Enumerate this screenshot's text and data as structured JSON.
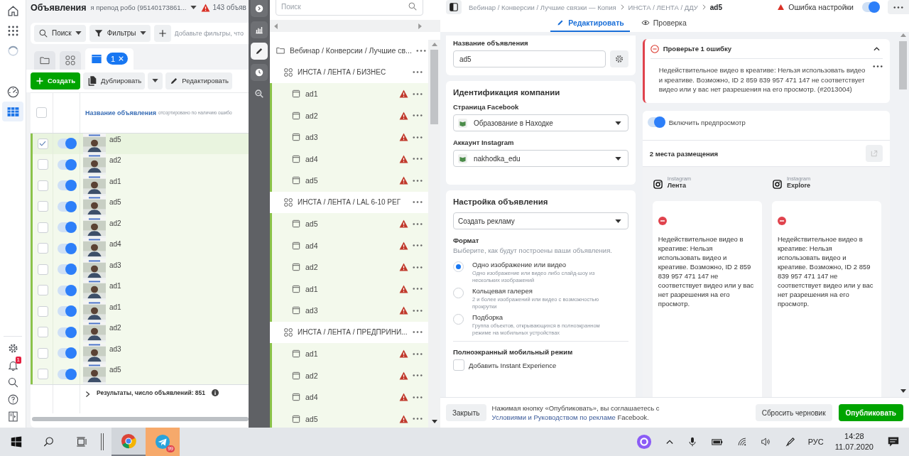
{
  "nav": {
    "items": [
      {
        "kind": "home",
        "selected": false
      },
      {
        "kind": "apps",
        "selected": false
      },
      {
        "kind": "loading",
        "selected": false
      },
      {
        "kind": "gauge",
        "selected": false
      },
      {
        "kind": "table",
        "selected": true
      }
    ],
    "bottom": [
      {
        "kind": "settings"
      },
      {
        "kind": "bell",
        "badge": "1"
      },
      {
        "kind": "search"
      },
      {
        "kind": "help"
      },
      {
        "kind": "panel"
      }
    ]
  },
  "ads": {
    "title": "Объявления",
    "account": "я препод робо (95140173861...",
    "warning": "143 объяв",
    "search": "Поиск",
    "filters": "Фильтры",
    "filter_placeholder": "Добавьте фильтры, что",
    "tabs": [
      {
        "kind": "campaigns",
        "selected": false
      },
      {
        "kind": "adsets",
        "selected": false
      },
      {
        "kind": "ads",
        "selected": true,
        "count": "1"
      }
    ],
    "create": "Создать",
    "duplicate": "Дублировать",
    "edit": "Редактировать",
    "table": {
      "all_checked": false,
      "column": "Название объявления",
      "sort_note": "отсортировано по наличию ошибо",
      "rows": [
        {
          "name": "ad5",
          "checked": true,
          "on": true
        },
        {
          "name": "ad2",
          "checked": false,
          "on": true
        },
        {
          "name": "ad1",
          "checked": false,
          "on": true
        },
        {
          "name": "ad5",
          "checked": false,
          "on": true
        },
        {
          "name": "ad2",
          "checked": false,
          "on": true
        },
        {
          "name": "ad4",
          "checked": false,
          "on": true
        },
        {
          "name": "ad3",
          "checked": false,
          "on": true
        },
        {
          "name": "ad1",
          "checked": false,
          "on": true
        },
        {
          "name": "ad1",
          "checked": false,
          "on": true
        },
        {
          "name": "ad2",
          "checked": false,
          "on": true
        },
        {
          "name": "ad3",
          "checked": false,
          "on": true
        },
        {
          "name": "ad5",
          "checked": false,
          "on": true
        }
      ],
      "footer": "Результаты, число объявлений: 851"
    }
  },
  "tools": [
    {
      "kind": "expand",
      "selected": false
    },
    {
      "kind": "chart",
      "selected": false
    },
    {
      "kind": "edit",
      "selected": true
    },
    {
      "kind": "history",
      "selected": false
    },
    {
      "kind": "inspect",
      "selected": false
    }
  ],
  "tree": {
    "search_placeholder": "Поиск",
    "items": [
      {
        "kind": "campaign",
        "label": "Вебинар / Конверсии / Лучшие св...",
        "children": [
          {
            "kind": "adset",
            "label": "ИНСТА / ЛЕНТА / БИЗНЕС",
            "children": [
              {
                "kind": "ad",
                "label": "ad1",
                "error": true
              },
              {
                "kind": "ad",
                "label": "ad2",
                "error": true
              },
              {
                "kind": "ad",
                "label": "ad3",
                "error": true
              },
              {
                "kind": "ad",
                "label": "ad4",
                "error": true
              },
              {
                "kind": "ad",
                "label": "ad5",
                "error": true
              }
            ]
          },
          {
            "kind": "adset",
            "label": "ИНСТА / ЛЕНТА / LAL 6-10 РЕГ",
            "children": [
              {
                "kind": "ad",
                "label": "ad5",
                "error": true
              },
              {
                "kind": "ad",
                "label": "ad4",
                "error": true
              },
              {
                "kind": "ad",
                "label": "ad2",
                "error": true
              },
              {
                "kind": "ad",
                "label": "ad1",
                "error": true
              },
              {
                "kind": "ad",
                "label": "ad3",
                "error": true
              }
            ]
          },
          {
            "kind": "adset",
            "label": "ИНСТА / ЛЕНТА / ПРЕДПРИНИ...",
            "children": [
              {
                "kind": "ad",
                "label": "ad1",
                "error": true
              },
              {
                "kind": "ad",
                "label": "ad2",
                "error": true
              },
              {
                "kind": "ad",
                "label": "ad4",
                "error": true
              },
              {
                "kind": "ad",
                "label": "ad5",
                "error": true
              }
            ]
          }
        ]
      }
    ]
  },
  "editor": {
    "header": {
      "breadcrumb": [
        "Вебинар / Конверсии / Лучшие связки — Копия",
        "ИНСТА / ЛЕНТА / ДДУ",
        "ad5"
      ],
      "status": "Ошибка настройки",
      "enabled": true
    },
    "tabs": [
      {
        "kind": "edit",
        "label": "Редактировать",
        "selected": true
      },
      {
        "kind": "review",
        "label": "Проверка",
        "selected": false
      }
    ],
    "name_label": "Название объявления",
    "name_value": "ad5",
    "identity": {
      "title": "Идентификация компании",
      "page_label": "Страница Facebook",
      "page_value": "Образование в Находке",
      "ig_label": "Аккаунт Instagram",
      "ig_value": "nakhodka_edu"
    },
    "setup": {
      "title": "Настройка объявления",
      "mode": "Создать рекламу",
      "format_label": "Формат",
      "format_hint": "Выберите, как будут построены ваши объявления.",
      "formats": [
        {
          "label": "Одно изображение или видео",
          "description": "Одно изображение или видео либо слайд-шоу из нескольких изображений",
          "selected": true
        },
        {
          "label": "Кольцевая галерея",
          "description": "2 и более изображений или видео с возможностью прокрутки",
          "selected": false
        },
        {
          "label": "Подборка",
          "description": "Группа объектов, открывающихся в полноэкранном режиме на мобильных устройствах",
          "selected": false
        }
      ],
      "fullscreen_title": "Полноэкранный мобильный режим",
      "instant": {
        "label": "Добавить Instant Experience",
        "checked": false
      }
    },
    "errors": {
      "title": "Проверьте 1 ошибку",
      "expanded": true,
      "message": "Недействительное видео в креативе: Нельзя использовать видео и креативе. Возможно, ID 2 859 839 957 471 147 не соответствует видео или у вас нет разрешения на его просмотр. (#2013004)"
    },
    "preview": {
      "label": "Включить предпросмотр",
      "enabled": true,
      "placements_title": "2 места размещения",
      "placements": [
        {
          "platform": "Instagram",
          "name": "Лента",
          "message": "Недействительное видео в креативе: Нельзя использовать видео и креативе. Возможно, ID 2 859 839 957 471 147 не соответствует видео или у вас нет разрешения на его просмотр."
        },
        {
          "platform": "Instagram",
          "name": "Explore",
          "message": "Недействительное видео в креативе: Нельзя использовать видео и креативе. Возможно, ID 2 859 839 957 471 147 не соответствует видео или у вас нет разрешения на его просмотр."
        }
      ]
    },
    "footer": {
      "close": "Закрыть",
      "notice": "Нажимая кнопку «Опубликовать», вы соглашаетесь с",
      "link": "Условиями и Руководством по рекламе",
      "notice_end": "Facebook.",
      "reset": "Сбросить черновик",
      "publish": "Опубликовать"
    }
  },
  "taskbar": {
    "telegram_badge": "99",
    "language": "РУС",
    "time": "14:28",
    "date": "11.07.2020"
  }
}
